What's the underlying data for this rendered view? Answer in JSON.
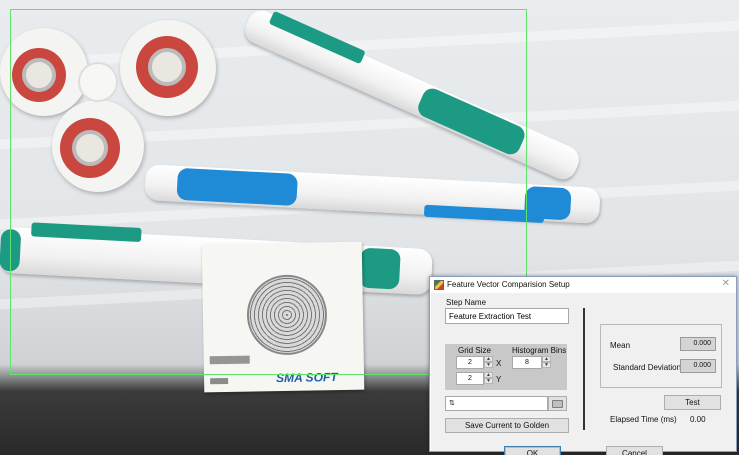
{
  "dialog": {
    "title": "Feature Vector Comparision Setup",
    "step_name_label": "Step Name",
    "step_name_value": "Feature Extraction Test",
    "grid_size_label": "Grid Size",
    "histogram_bins_label": "Histogram Bins",
    "grid_x_value": "2",
    "grid_x_axis": "X",
    "grid_y_value": "2",
    "grid_y_axis": "Y",
    "bins_value": "8",
    "file_path_value": "",
    "save_golden_label": "Save Current to Golden",
    "mean_label": "Mean",
    "mean_value": "0.000",
    "std_label": "Standard Deviation",
    "std_value": "0.000",
    "test_label": "Test",
    "elapsed_label": "Elapsed Time (ms)",
    "elapsed_value": "0.00",
    "ok_label": "OK",
    "cancel_label": "Cancel"
  },
  "scene": {
    "card_logo": "SMA SOFT",
    "roi_color": "#5fe36b"
  },
  "icons": [
    "app-icon",
    "close-icon",
    "spin-up-icon",
    "spin-down-icon",
    "folder-icon",
    "file-type-icon"
  ]
}
